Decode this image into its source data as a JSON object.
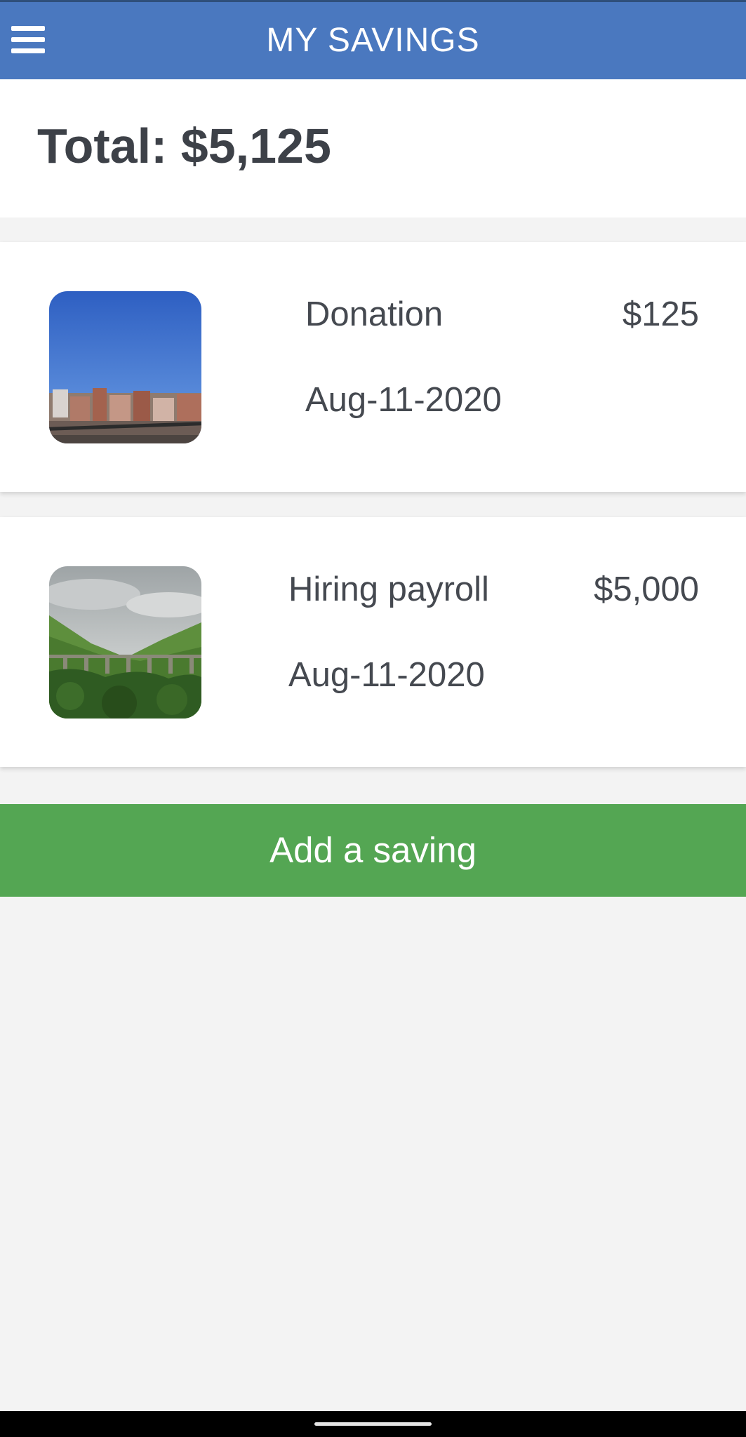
{
  "header": {
    "title": "MY SAVINGS",
    "menu_icon": "hamburger-menu-icon",
    "background_color": "#4a78bf"
  },
  "summary": {
    "total_text": "Total: $5,125"
  },
  "savings": [
    {
      "title": "Donation",
      "amount": "$125",
      "date": "Aug-11-2020",
      "image": "city-rooftops-photo"
    },
    {
      "title": "Hiring payroll",
      "amount": "$5,000",
      "date": "Aug-11-2020",
      "image": "green-valley-viaduct-photo"
    }
  ],
  "actions": {
    "add_label": "Add a saving",
    "button_color": "#54a653"
  }
}
